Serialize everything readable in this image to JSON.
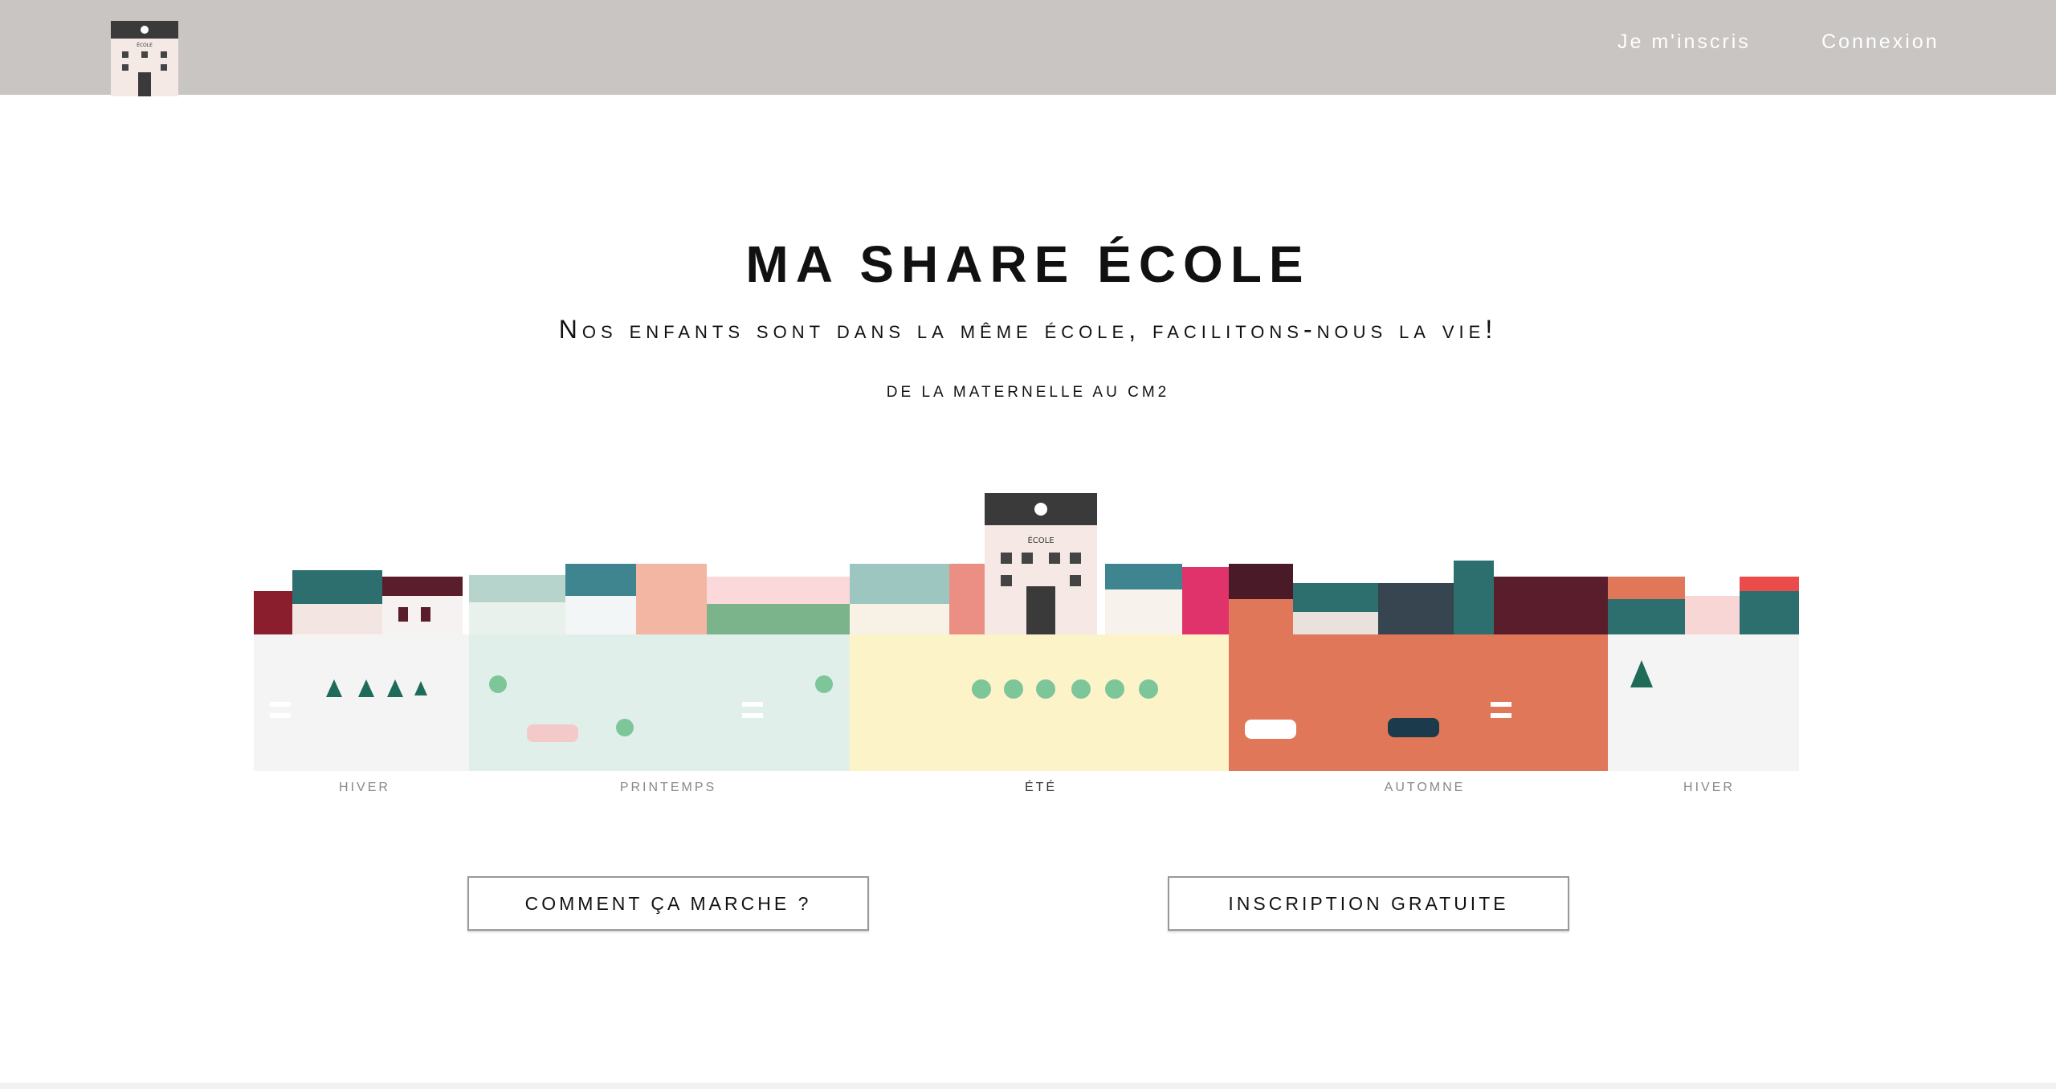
{
  "header": {
    "logo_icon": "school-building-icon",
    "nav": [
      {
        "label": "Je m'inscris"
      },
      {
        "label": "Connexion"
      }
    ],
    "bg_color": "#c8c5c3"
  },
  "hero": {
    "title": "MA SHARE ÉCOLE",
    "subtitle": "Nos enfants sont dans la même école, facilitons-nous la vie!",
    "tagline": "DE LA MATERNELLE AU CM2"
  },
  "illustration": {
    "seasons": [
      {
        "label": "HIVER",
        "color": "#f4f4f4"
      },
      {
        "label": "PRINTEMPS",
        "color": "#e0efe9"
      },
      {
        "label": "ÉTÉ",
        "color": "#fcf3c8"
      },
      {
        "label": "AUTOMNE",
        "color": "#e07758"
      },
      {
        "label": "HIVER",
        "color": "#f4f4f4"
      }
    ],
    "school_sign": "ÉCOLE"
  },
  "actions": {
    "how_it_works": "COMMENT ÇA MARCHE ?",
    "signup_free": "INSCRIPTION GRATUITE"
  }
}
